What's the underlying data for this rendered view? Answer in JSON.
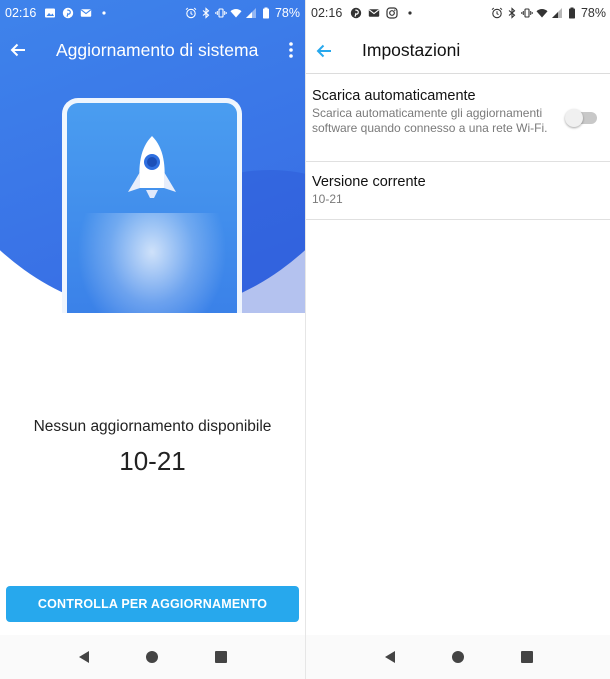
{
  "left": {
    "statusbar": {
      "time": "02:16",
      "notification_icons": [
        "image-icon",
        "pinterest-icon",
        "mail-icon",
        "dot-icon"
      ],
      "system_icons": [
        "alarm-icon",
        "bluetooth-icon",
        "vibrate-icon",
        "wifi-icon",
        "signal-icon",
        "battery-icon"
      ],
      "battery": "78%"
    },
    "appbar": {
      "title": "Aggiornamento di sistema",
      "back_icon": "arrow-back-icon",
      "menu_icon": "more-vert-icon"
    },
    "status_message": "Nessun aggiornamento disponibile",
    "version": "10-21",
    "check_button": "CONTROLLA PER AGGIORNAMENTO",
    "navbar": [
      "back-nav-icon",
      "home-nav-icon",
      "recents-nav-icon"
    ],
    "colors": {
      "hero_start": "#4aa7f2",
      "hero_end": "#3667e3",
      "button": "#27a8ed"
    }
  },
  "right": {
    "statusbar": {
      "time": "02:16",
      "notification_icons": [
        "pinterest-icon",
        "mail-icon",
        "instagram-icon",
        "dot-icon"
      ],
      "system_icons": [
        "alarm-icon",
        "bluetooth-icon",
        "vibrate-icon",
        "wifi-icon",
        "signal-icon",
        "battery-icon"
      ],
      "battery": "78%"
    },
    "appbar": {
      "title": "Impostazioni",
      "back_icon": "arrow-back-icon"
    },
    "settings": [
      {
        "label": "Scarica automaticamente",
        "description": "Scarica automaticamente gli aggiornamenti software quando connesso a una rete Wi-Fi.",
        "toggle": "off"
      },
      {
        "label": "Versione corrente",
        "value": "10-21"
      }
    ],
    "navbar": [
      "back-nav-icon",
      "home-nav-icon",
      "recents-nav-icon"
    ],
    "colors": {
      "accent": "#27a8ed"
    }
  }
}
